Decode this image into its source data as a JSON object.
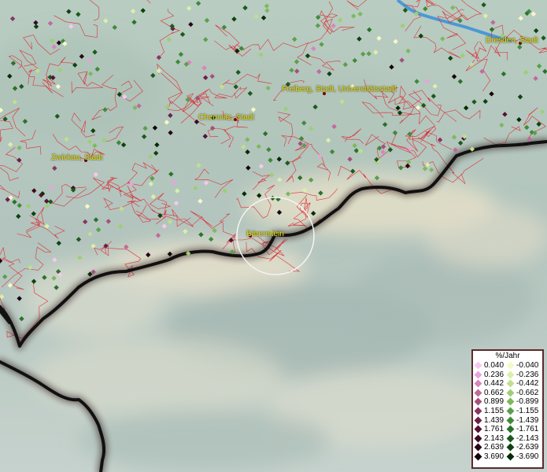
{
  "map": {
    "cities": [
      {
        "name": "Dresden, Stadt",
        "dot_color": "#6a0a0a"
      },
      {
        "name": "Freiberg, Stadt, Universitätsstadt",
        "dot_color": "#6a0a0a"
      },
      {
        "name": "Chemnitz, Stadt",
        "dot_color": "#6a0a0a"
      },
      {
        "name": "Zwickau, Stadt",
        "dot_color": "#6a0a0a"
      },
      {
        "name": "Bärenstein",
        "dot_color": "#6a0a0a"
      }
    ],
    "colors": {
      "background": "#b9c9bf",
      "district_lines": "#e0202a",
      "border": "#111111",
      "river": "#3a8fd8",
      "label": "#e8e000"
    }
  },
  "legend": {
    "title": "%/Jahr",
    "rows": [
      {
        "pos": "0.040",
        "pos_color": "#f7c8ef",
        "neg": "-0.040",
        "neg_color": "#f6f8c8"
      },
      {
        "pos": "0.236",
        "pos_color": "#e9a3d9",
        "neg": "-0.236",
        "neg_color": "#dcefa9"
      },
      {
        "pos": "0.442",
        "pos_color": "#d885bd",
        "neg": "-0.442",
        "neg_color": "#bfe08e"
      },
      {
        "pos": "0.662",
        "pos_color": "#c06a9b",
        "neg": "-0.662",
        "neg_color": "#9fce74"
      },
      {
        "pos": "0.899",
        "pos_color": "#a5507d",
        "neg": "-0.899",
        "neg_color": "#7db95e"
      },
      {
        "pos": "1.155",
        "pos_color": "#873662",
        "neg": "-1.155",
        "neg_color": "#5aa04a"
      },
      {
        "pos": "1.439",
        "pos_color": "#6b2149",
        "neg": "-1.439",
        "neg_color": "#3f8a39"
      },
      {
        "pos": "1.761",
        "pos_color": "#531235",
        "neg": "-1.761",
        "neg_color": "#2b7229"
      },
      {
        "pos": "2.143",
        "pos_color": "#3d0a24",
        "neg": "-2.143",
        "neg_color": "#1b5a1b"
      },
      {
        "pos": "2.639",
        "pos_color": "#280515",
        "neg": "-2.639",
        "neg_color": "#0e420f"
      },
      {
        "pos": "3.690",
        "pos_color": "#14020a",
        "neg": "-3.690",
        "neg_color": "#052a06"
      }
    ]
  }
}
